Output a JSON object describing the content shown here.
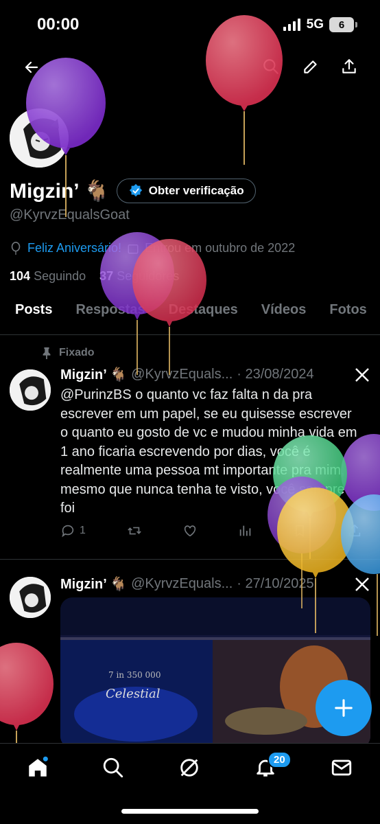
{
  "status_bar": {
    "time": "00:00",
    "network": "5G",
    "battery": "6"
  },
  "profile": {
    "display_name": "Migzin’ 🐐",
    "handle": "@KyrvzEqualsGoat",
    "verify_button": "Obter verificação",
    "birthday": "Feliz Aniversário!",
    "joined": "Entrou em outubro de 2022",
    "following_count": "104",
    "following_label": "Seguindo",
    "followers_count": "37",
    "followers_label": "Seguidores"
  },
  "tabs": [
    "Posts",
    "Respostas",
    "Destaques",
    "Vídeos",
    "Fotos"
  ],
  "pinned_label": "Fixado",
  "tweets": [
    {
      "name": "Migzin’ 🐐",
      "handle": "@KyrvzEquals...",
      "date": "· 23/08/2024",
      "text": "@PurinzBS o quanto vc faz falta n da pra escrever em um papel, se eu quisesse escrever o quanto eu gosto de vc e mudou minha vida em 1 ano ficaria escrevendo por dias, você é realmente uma pessoa mt importante pra mim, mesmo que nunca tenha te visto, você sempre foi",
      "replies": "1"
    },
    {
      "name": "Migzin’ 🐐",
      "handle": "@KyrvzEquals...",
      "date": "· 27/10/2025",
      "media_text": "Celestial",
      "media_sub": "7 in 350 000"
    }
  ],
  "nav": {
    "notifications_badge": "20"
  },
  "colors": {
    "accent": "#1d9bf0",
    "background": "#000000",
    "muted": "#71767b"
  }
}
